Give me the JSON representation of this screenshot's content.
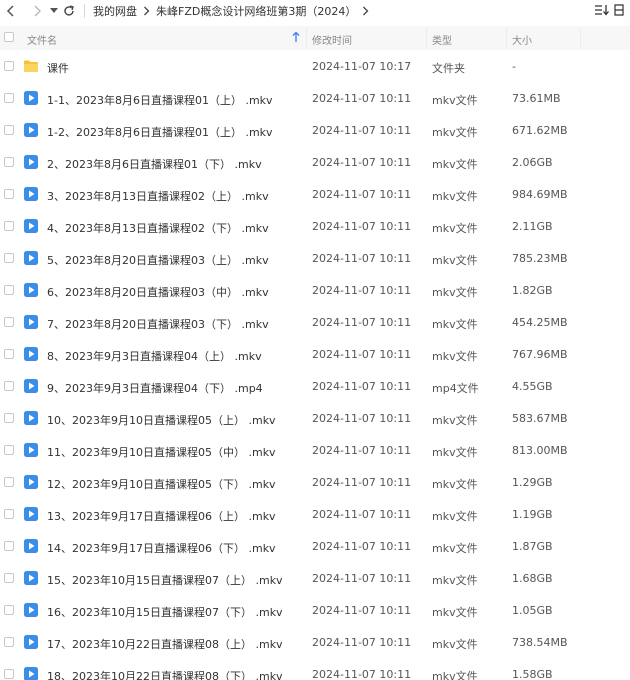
{
  "nav": {
    "back_icon": "chevron-left-icon",
    "forward_icon": "chevron-right-icon",
    "dropdown_icon": "caret-down-icon",
    "refresh_icon": "refresh-icon"
  },
  "breadcrumb": [
    {
      "label": "我的网盘"
    },
    {
      "label": "朱峰FZD概念设计网络班第3期（2024）"
    }
  ],
  "columns": {
    "name": "文件名",
    "modified": "修改时间",
    "type": "类型",
    "size": "大小"
  },
  "sort": {
    "column": "name",
    "direction": "asc"
  },
  "colors": {
    "accent": "#3a7ef5",
    "folder": "#f8c13a",
    "video": "#3a8ee8"
  },
  "files": [
    {
      "name": "课件",
      "modified": "2024-11-07 10:17",
      "type": "文件夹",
      "size": "-",
      "icon": "folder-icon"
    },
    {
      "name": "1-1、2023年8月6日直播课程01（上） .mkv",
      "modified": "2024-11-07 10:11",
      "type": "mkv文件",
      "size": "73.61MB",
      "icon": "video-file-icon"
    },
    {
      "name": "1-2、2023年8月6日直播课程01（上） .mkv",
      "modified": "2024-11-07 10:11",
      "type": "mkv文件",
      "size": "671.62MB",
      "icon": "video-file-icon"
    },
    {
      "name": "2、2023年8月6日直播课程01（下） .mkv",
      "modified": "2024-11-07 10:11",
      "type": "mkv文件",
      "size": "2.06GB",
      "icon": "video-file-icon"
    },
    {
      "name": "3、2023年8月13日直播课程02（上） .mkv",
      "modified": "2024-11-07 10:11",
      "type": "mkv文件",
      "size": "984.69MB",
      "icon": "video-file-icon"
    },
    {
      "name": "4、2023年8月13日直播课程02（下） .mkv",
      "modified": "2024-11-07 10:11",
      "type": "mkv文件",
      "size": "2.11GB",
      "icon": "video-file-icon"
    },
    {
      "name": "5、2023年8月20日直播课程03（上） .mkv",
      "modified": "2024-11-07 10:11",
      "type": "mkv文件",
      "size": "785.23MB",
      "icon": "video-file-icon"
    },
    {
      "name": "6、2023年8月20日直播课程03（中） .mkv",
      "modified": "2024-11-07 10:11",
      "type": "mkv文件",
      "size": "1.82GB",
      "icon": "video-file-icon"
    },
    {
      "name": "7、2023年8月20日直播课程03（下） .mkv",
      "modified": "2024-11-07 10:11",
      "type": "mkv文件",
      "size": "454.25MB",
      "icon": "video-file-icon"
    },
    {
      "name": "8、2023年9月3日直播课程04（上） .mkv",
      "modified": "2024-11-07 10:11",
      "type": "mkv文件",
      "size": "767.96MB",
      "icon": "video-file-icon"
    },
    {
      "name": "9、2023年9月3日直播课程04（下） .mp4",
      "modified": "2024-11-07 10:11",
      "type": "mp4文件",
      "size": "4.55GB",
      "icon": "video-file-icon"
    },
    {
      "name": "10、2023年9月10日直播课程05（上） .mkv",
      "modified": "2024-11-07 10:11",
      "type": "mkv文件",
      "size": "583.67MB",
      "icon": "video-file-icon"
    },
    {
      "name": "11、2023年9月10日直播课程05（中） .mkv",
      "modified": "2024-11-07 10:11",
      "type": "mkv文件",
      "size": "813.00MB",
      "icon": "video-file-icon"
    },
    {
      "name": "12、2023年9月10日直播课程05（下） .mkv",
      "modified": "2024-11-07 10:11",
      "type": "mkv文件",
      "size": "1.29GB",
      "icon": "video-file-icon"
    },
    {
      "name": "13、2023年9月17日直播课程06（上） .mkv",
      "modified": "2024-11-07 10:11",
      "type": "mkv文件",
      "size": "1.19GB",
      "icon": "video-file-icon"
    },
    {
      "name": "14、2023年9月17日直播课程06（下） .mkv",
      "modified": "2024-11-07 10:11",
      "type": "mkv文件",
      "size": "1.87GB",
      "icon": "video-file-icon"
    },
    {
      "name": "15、2023年10月15日直播课程07（上） .mkv",
      "modified": "2024-11-07 10:11",
      "type": "mkv文件",
      "size": "1.68GB",
      "icon": "video-file-icon"
    },
    {
      "name": "16、2023年10月15日直播课程07（下） .mkv",
      "modified": "2024-11-07 10:11",
      "type": "mkv文件",
      "size": "1.05GB",
      "icon": "video-file-icon"
    },
    {
      "name": "17、2023年10月22日直播课程08（上） .mkv",
      "modified": "2024-11-07 10:11",
      "type": "mkv文件",
      "size": "738.54MB",
      "icon": "video-file-icon"
    },
    {
      "name": "18、2023年10月22日直播课程08（下） .mkv",
      "modified": "2024-11-07 10:11",
      "type": "mkv文件",
      "size": "1.58GB",
      "icon": "video-file-icon"
    }
  ]
}
